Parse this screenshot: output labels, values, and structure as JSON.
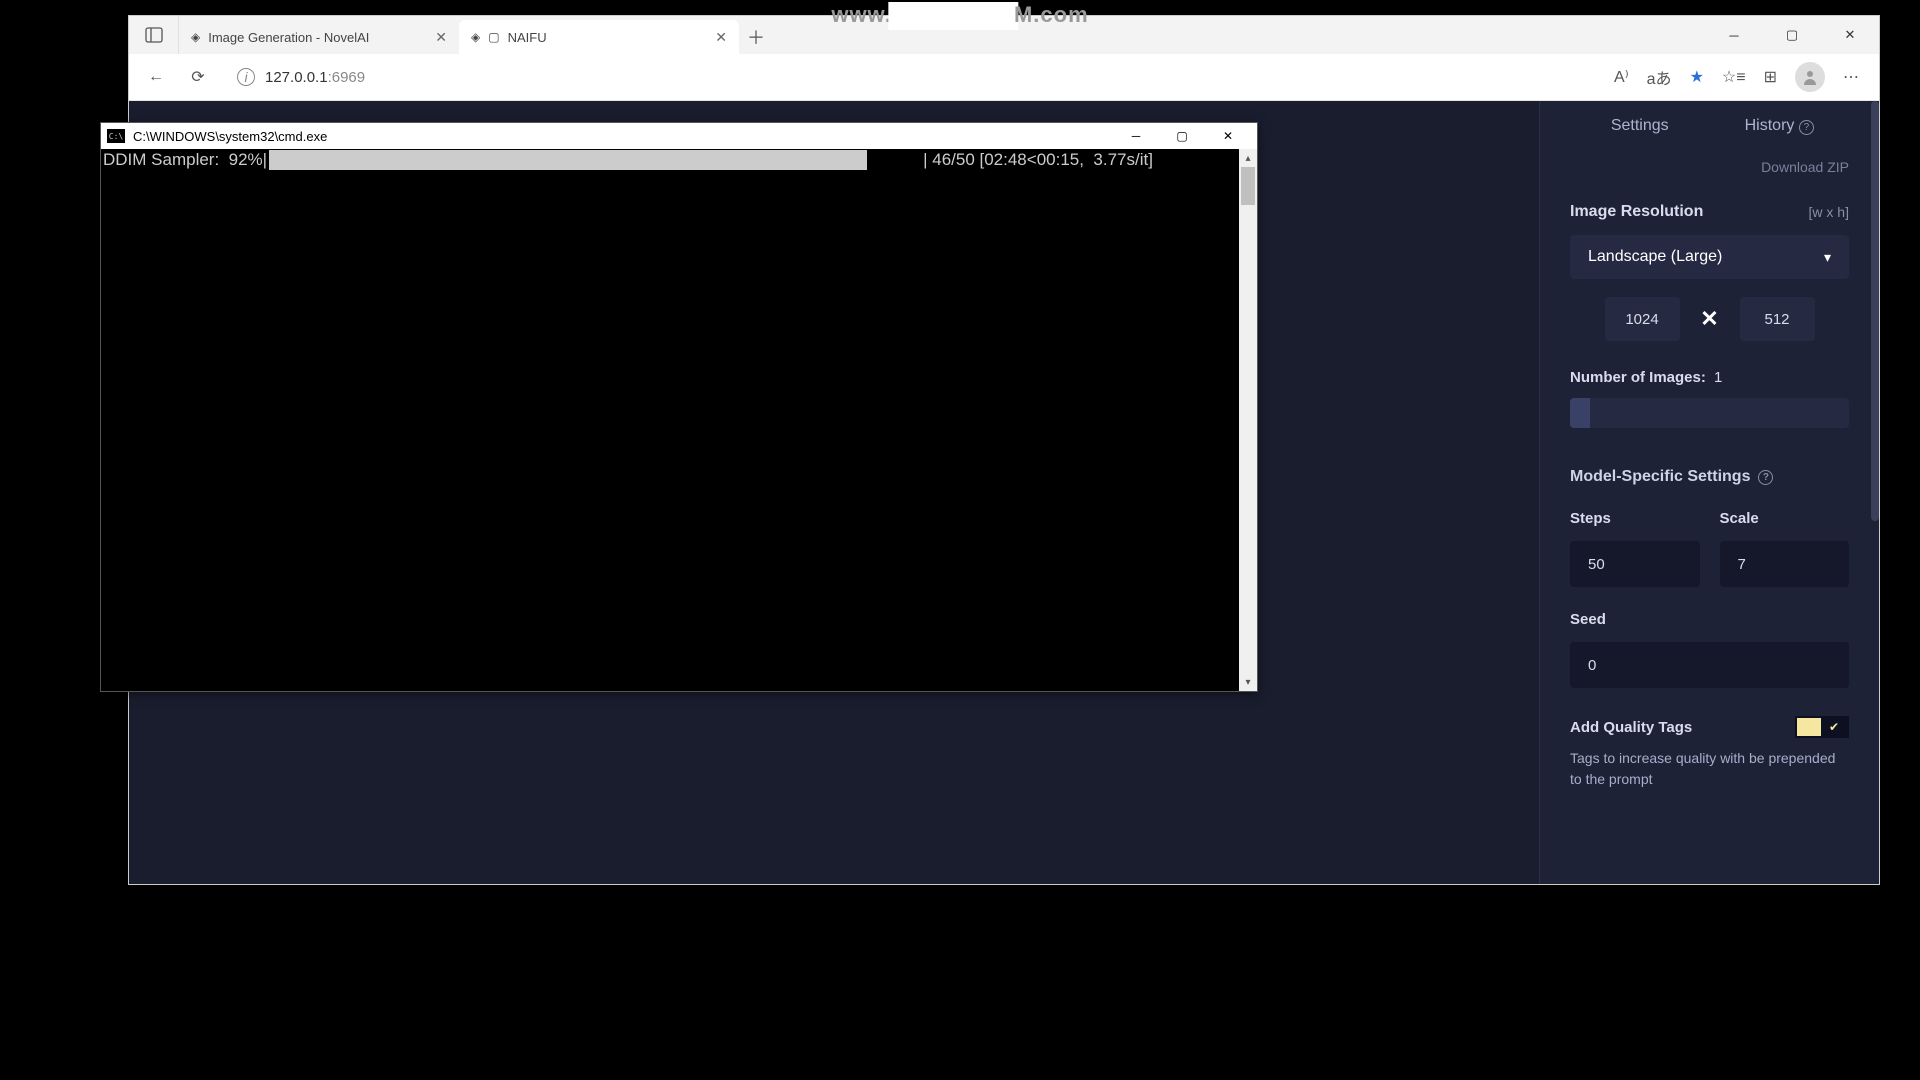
{
  "watermark": {
    "left": "www.",
    "right": "M.com"
  },
  "browser": {
    "tabs": [
      {
        "title": "Image Generation - NovelAI",
        "active": false
      },
      {
        "title": "NAIFU",
        "active": true
      }
    ],
    "address": {
      "host": "127.0.0.1",
      "port": ":6969"
    },
    "toolbar": {
      "read_aloud": "A⁾",
      "translate": "aあ",
      "star": "★",
      "favorites": "☆≡",
      "collections": "⊞",
      "more": "⋯"
    }
  },
  "cmd": {
    "title": "C:\\WINDOWS\\system32\\cmd.exe",
    "sampler_label": "DDIM Sampler:",
    "percent": "92%",
    "stats": "| 46/50 [02:48<00:15,  3.77s/it]",
    "progress_ratio": 0.92
  },
  "settings": {
    "tab_settings": "Settings",
    "tab_history": "History",
    "download_zip": "Download ZIP",
    "resolution_label": "Image Resolution",
    "resolution_hint": "[w x h]",
    "resolution_value": "Landscape (Large)",
    "width": "1024",
    "height": "512",
    "dim_sep": "✕",
    "num_images_label": "Number of Images:",
    "num_images_value": "1",
    "model_section": "Model-Specific Settings",
    "steps_label": "Steps",
    "steps_value": "50",
    "scale_label": "Scale",
    "scale_value": "7",
    "seed_label": "Seed",
    "seed_value": "0",
    "quality_label": "Add Quality Tags",
    "quality_check": "✔",
    "quality_hint": "Tags to increase quality with be prepended to the prompt"
  }
}
